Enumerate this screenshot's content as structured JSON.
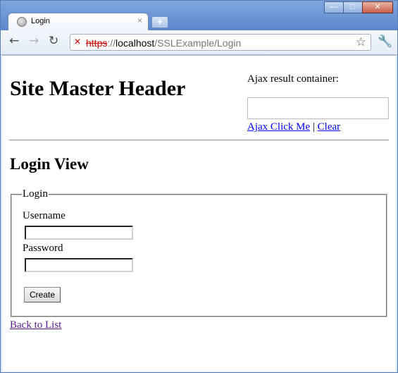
{
  "browser": {
    "tab_title": "Login",
    "tab_close": "×",
    "new_tab": "+",
    "url_scheme": "https",
    "url_sep": "://",
    "url_host": "localhost",
    "url_path": "/SSLExample/Login",
    "window_buttons": {
      "minimize": "—",
      "maximize": "□",
      "close": "✕"
    },
    "nav": {
      "back": "←",
      "forward": "→",
      "reload": "↻",
      "star": "☆",
      "wrench": "🔧"
    }
  },
  "header": {
    "title": "Site Master Header",
    "ajax_label": "Ajax result container:",
    "ajax_click": "Ajax Click Me",
    "separator": "|",
    "clear": "Clear"
  },
  "main": {
    "view_title": "Login View",
    "fieldset_legend": "Login",
    "username_label": "Username",
    "username_value": "",
    "password_label": "Password",
    "password_value": "",
    "create_button": "Create",
    "back_link": "Back to List"
  }
}
